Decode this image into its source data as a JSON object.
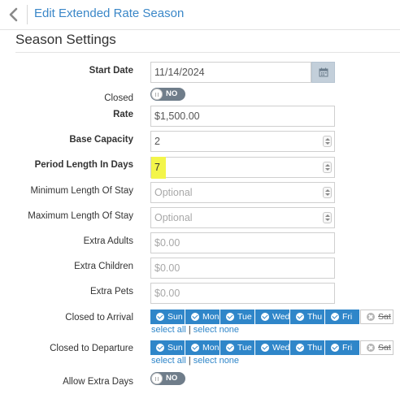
{
  "header": {
    "title": "Edit Extended Rate Season",
    "back_icon": "chevron-left-icon"
  },
  "section": {
    "title": "Season Settings"
  },
  "colors": {
    "accent": "#2f86c9",
    "title_link": "#3a87c8",
    "toggle_off": "#6f7d8a",
    "highlight": "#f3f54a"
  },
  "fields": {
    "start_date": {
      "label": "Start Date",
      "value": "11/14/2024"
    },
    "closed": {
      "label": "Closed",
      "toggle": "NO"
    },
    "rate": {
      "label": "Rate",
      "value": "$1,500.00"
    },
    "base_capacity": {
      "label": "Base Capacity",
      "value": "2"
    },
    "period_length": {
      "label": "Period Length In Days",
      "value": "7"
    },
    "min_stay": {
      "label": "Minimum Length Of Stay",
      "placeholder": "Optional"
    },
    "max_stay": {
      "label": "Maximum Length Of Stay",
      "placeholder": "Optional"
    },
    "extra_adults": {
      "label": "Extra Adults",
      "placeholder": "$0.00"
    },
    "extra_children": {
      "label": "Extra Children",
      "placeholder": "$0.00"
    },
    "extra_pets": {
      "label": "Extra Pets",
      "placeholder": "$0.00"
    },
    "closed_to_arrival": {
      "label": "Closed to Arrival"
    },
    "closed_to_departure": {
      "label": "Closed to Departure"
    },
    "allow_extra_days": {
      "label": "Allow Extra Days",
      "toggle": "NO"
    }
  },
  "days": {
    "sun": "Sun",
    "mon": "Mon",
    "tue": "Tue",
    "wed": "Wed",
    "thu": "Thu",
    "fri": "Fri",
    "sat": "Sat",
    "checked": [
      "Sun",
      "Mon",
      "Tue",
      "Wed",
      "Thu",
      "Fri"
    ],
    "unchecked": [
      "Sat"
    ]
  },
  "links": {
    "select_all": "select all",
    "separator": "|",
    "select_none": "select none"
  }
}
